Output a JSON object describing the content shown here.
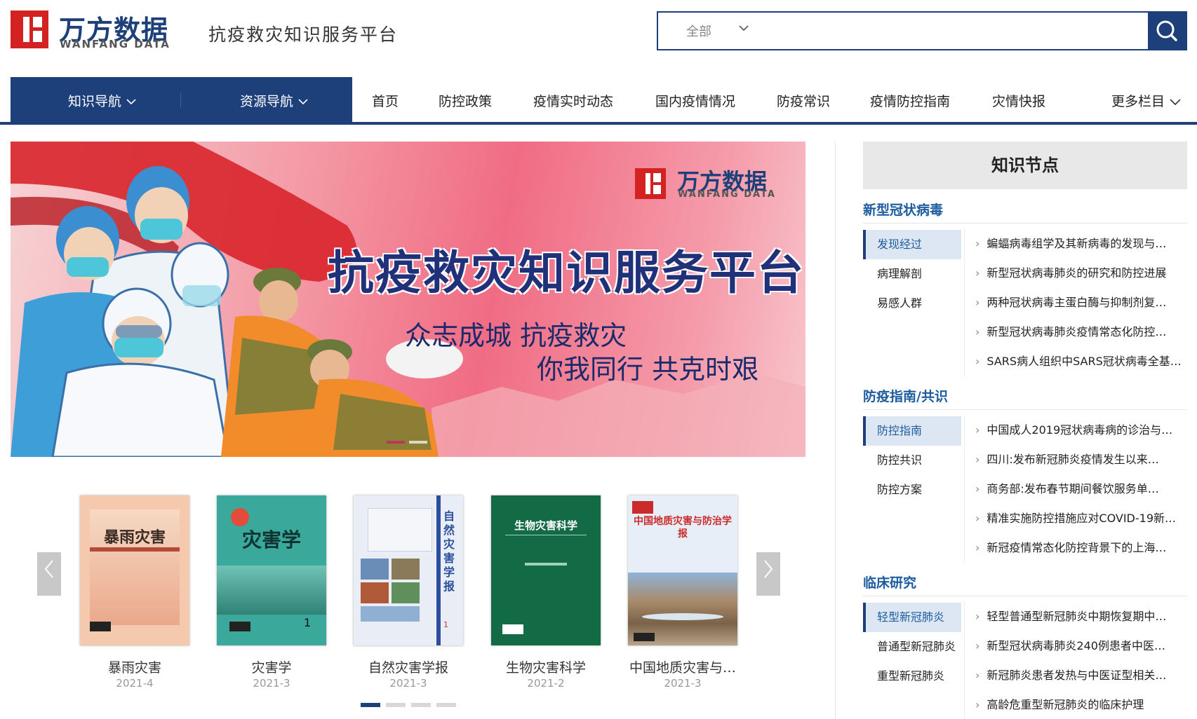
{
  "header": {
    "logo_cn": "万方数据",
    "logo_en": "WANFANG DATA",
    "platform_title": "抗疫救灾知识服务平台",
    "search_scope": "全部",
    "search_placeholder": ""
  },
  "nav": {
    "dark_items": [
      "知识导航",
      "资源导航"
    ],
    "items": [
      "首页",
      "防控政策",
      "疫情实时动态",
      "国内疫情情况",
      "防疫常识",
      "疫情防控指南",
      "灾情快报",
      "更多栏目"
    ]
  },
  "banner": {
    "logo_cn": "万方数据",
    "logo_en": "WANFANG DATA",
    "title": "抗疫救灾知识服务平台",
    "slogan_line1": "众志成城 抗疫救灾",
    "slogan_line2": "你我同行 共克时艰"
  },
  "journals": [
    {
      "name": "暴雨灾害",
      "date": "2021-4",
      "cover_title": "暴雨灾害",
      "cover_color": "#f4c9ad"
    },
    {
      "name": "灾害学",
      "date": "2021-3",
      "cover_title": "灾害学",
      "cover_color": "#3aa89a"
    },
    {
      "name": "自然灾害学报",
      "date": "2021-3",
      "cover_title": "自然灾害学报",
      "cover_color": "#e9eef6"
    },
    {
      "name": "生物灾害科学",
      "date": "2021-2",
      "cover_title": "生物灾害科学",
      "cover_color": "#136b45"
    },
    {
      "name": "中国地质灾害与…",
      "date": "2021-3",
      "cover_title": "中国地质灾害与防治学报",
      "cover_color": "#e7eef7"
    }
  ],
  "knowledge": {
    "title": "知识节点",
    "sections": [
      {
        "title": "新型冠状病毒",
        "tabs": [
          "发现经过",
          "病理解剖",
          "易感人群"
        ],
        "links": [
          "蝙蝠病毒组学及其新病毒的发现与…",
          "新型冠状病毒肺炎的研究和防控进展",
          "两种冠状病毒主蛋白酶与抑制剂复…",
          "新型冠状病毒肺炎疫情常态化防控…",
          "SARS病人组织中SARS冠状病毒全基…"
        ]
      },
      {
        "title": "防疫指南/共识",
        "tabs": [
          "防控指南",
          "防控共识",
          "防控方案"
        ],
        "links": [
          "中国成人2019冠状病毒病的诊治与…",
          "四川:发布新冠肺炎疫情发生以来…",
          "商务部:发布春节期间餐饮服务单…",
          "精准实施防控措施应对COVID-19新…",
          "新冠疫情常态化防控背景下的上海…"
        ]
      },
      {
        "title": "临床研究",
        "tabs": [
          "轻型新冠肺炎",
          "普通型新冠肺炎",
          "重型新冠肺炎"
        ],
        "links": [
          "轻型普通型新冠肺炎中期恢复期中…",
          "新型冠状病毒肺炎240例患者中医…",
          "新冠肺炎患者发热与中医证型相关…",
          "高龄危重型新冠肺炎的临床护理"
        ]
      }
    ]
  },
  "colors": {
    "brand_navy": "#1d3f7a",
    "brand_red": "#d42121",
    "link_blue": "#1d5c9e"
  }
}
